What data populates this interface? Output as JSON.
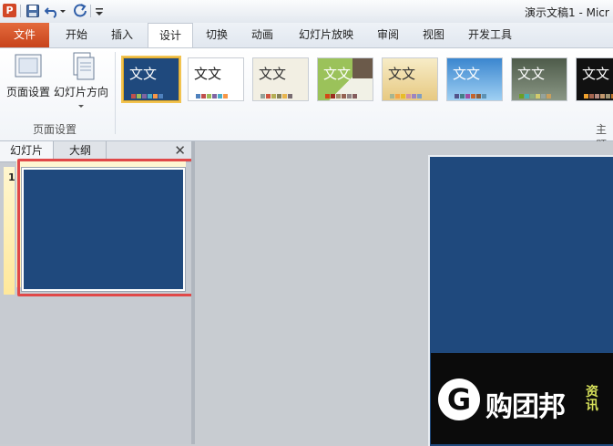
{
  "app": {
    "icon_letter": "P",
    "window_title": "演示文稿1 - Micr"
  },
  "quick_access": {
    "icons": [
      "save-icon",
      "undo-icon",
      "redo-icon",
      "customize-icon"
    ]
  },
  "ribbon_tabs": [
    {
      "label": "文件"
    },
    {
      "label": "开始"
    },
    {
      "label": "插入"
    },
    {
      "label": "设计"
    },
    {
      "label": "切换"
    },
    {
      "label": "动画"
    },
    {
      "label": "幻灯片放映"
    },
    {
      "label": "审阅"
    },
    {
      "label": "视图"
    },
    {
      "label": "开发工具"
    }
  ],
  "active_tab": "设计",
  "page_setup": {
    "page_setup_label": "页面设置",
    "orientation_label": "幻灯片方向",
    "group_label": "页面设置"
  },
  "themes": {
    "sample_text": "文文",
    "group_label_partial": "主题",
    "items": [
      {
        "name": "theme-office-blue",
        "bg": "#1f497d",
        "fg": "#ffffff"
      },
      {
        "name": "theme-white",
        "bg": "#ffffff",
        "fg": "#222222"
      },
      {
        "name": "theme-cream",
        "bg": "#f2efe3",
        "fg": "#333333"
      },
      {
        "name": "theme-green",
        "bg": "#9bc25a",
        "fg": "#ffffff"
      },
      {
        "name": "theme-tan",
        "bg": "#f0dba4",
        "fg": "#333333"
      },
      {
        "name": "theme-sky",
        "bg": "#4c9ad9",
        "fg": "#ffffff"
      },
      {
        "name": "theme-gray-green",
        "bg": "#6f7d6b",
        "fg": "#ffffff"
      },
      {
        "name": "theme-black",
        "bg": "#111111",
        "fg": "#ffffff"
      }
    ]
  },
  "left_pane": {
    "tab_slides": "幻灯片",
    "tab_outline": "大纲",
    "close_glyph": "✕",
    "slide_number": "1"
  },
  "colors": {
    "slide_bg": "#1f497d",
    "highlight": "#e04848",
    "file_tab": "#d24726"
  },
  "watermark": {
    "letter": "G",
    "text": "购团邦",
    "sub": "资讯"
  }
}
